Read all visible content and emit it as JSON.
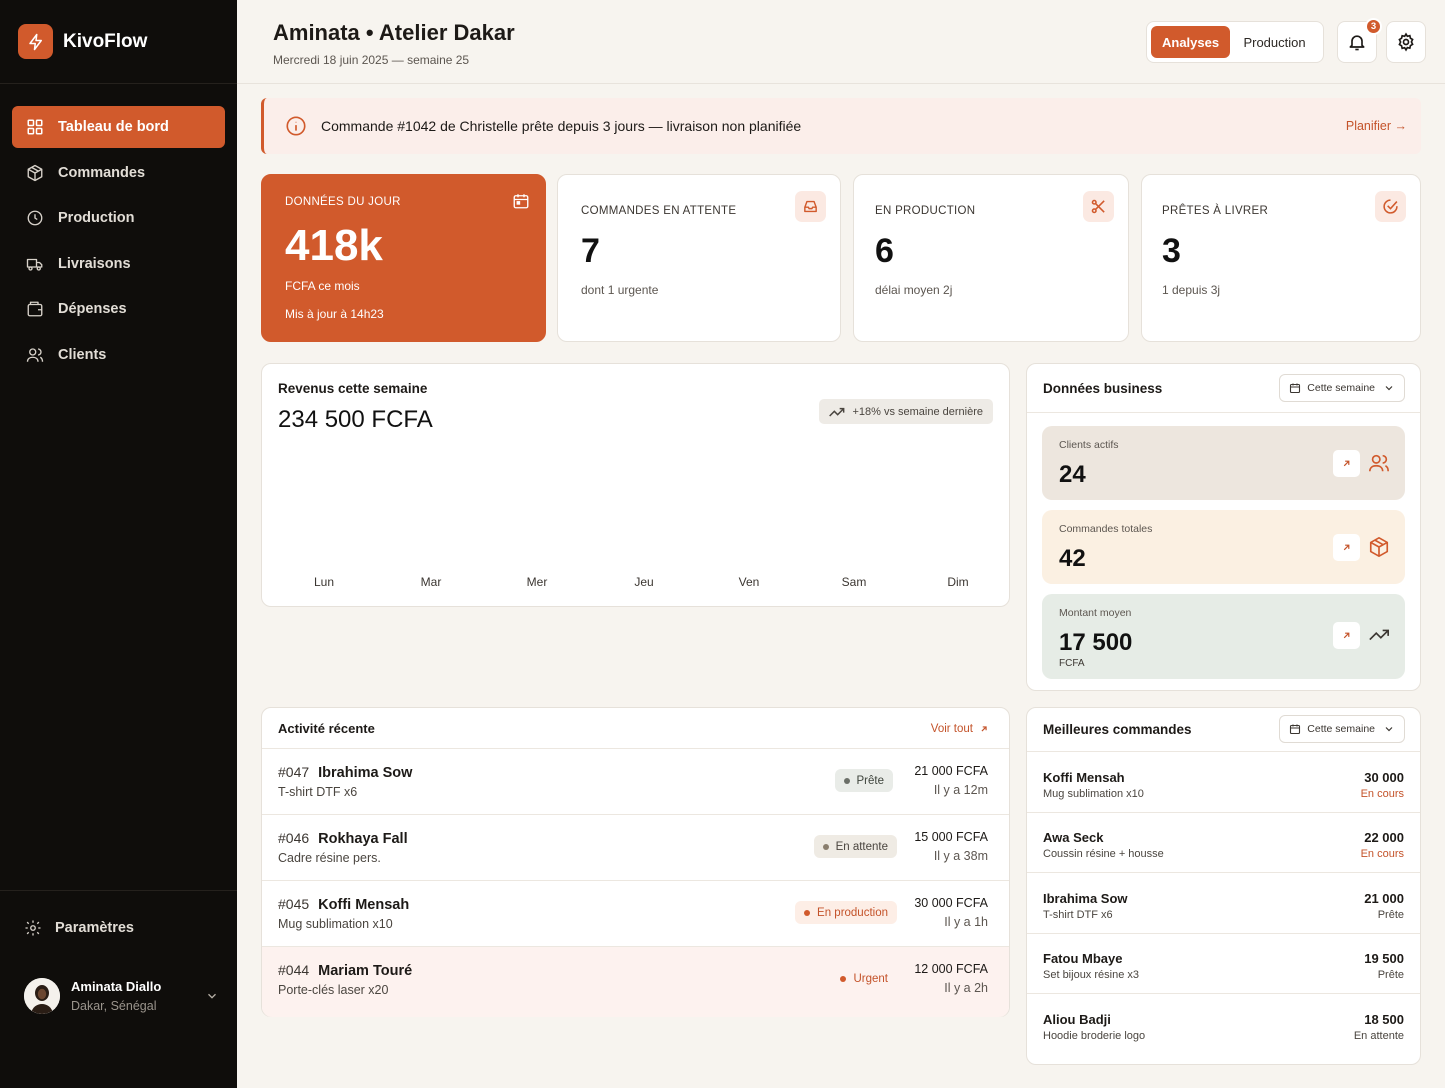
{
  "brand": {
    "name": "KivoFlow"
  },
  "nav": {
    "items": [
      {
        "label": "Tableau de bord",
        "icon": "dashboard-icon"
      },
      {
        "label": "Commandes",
        "icon": "box-icon"
      },
      {
        "label": "Production",
        "icon": "clock-icon"
      },
      {
        "label": "Livraisons",
        "icon": "truck-icon"
      },
      {
        "label": "Dépenses",
        "icon": "wallet-icon"
      },
      {
        "label": "Clients",
        "icon": "users-icon"
      }
    ],
    "settings": "Paramètres"
  },
  "user": {
    "name": "Aminata Diallo",
    "location": "Dakar, Sénégal"
  },
  "header": {
    "title": "Aminata • Atelier Dakar",
    "subtitle": "Mercredi 18 juin 2025 — semaine 25",
    "tabs": [
      "Analyses",
      "Production"
    ],
    "notifications": "3"
  },
  "alert": {
    "text": "Commande #1042 de Christelle prête depuis 3 jours — livraison non planifiée",
    "action": "Planifier →"
  },
  "stats": [
    {
      "label": "DONNÉES DU JOUR",
      "value": "418k",
      "sub": "FCFA ce mois",
      "sub2": "Mis à jour à 14h23"
    },
    {
      "label": "COMMANDES EN ATTENTE",
      "value": "7",
      "sub": "dont 1 urgente"
    },
    {
      "label": "EN PRODUCTION",
      "value": "6",
      "sub": "délai moyen 2j"
    },
    {
      "label": "PRÊTES À LIVRER",
      "value": "3",
      "sub": "1 depuis 3j"
    }
  ],
  "revenue": {
    "title": "Revenus cette semaine",
    "value": "234 500 FCFA",
    "trend": "+18% vs semaine dernière",
    "days": [
      "Lun",
      "Mar",
      "Mer",
      "Jeu",
      "Ven",
      "Sam",
      "Dim"
    ]
  },
  "business": {
    "title": "Données business",
    "period": "Cette semaine",
    "items": [
      {
        "label": "Clients actifs",
        "value": "24",
        "unit": ""
      },
      {
        "label": "Commandes totales",
        "value": "42",
        "unit": ""
      },
      {
        "label": "Montant moyen",
        "value": "17 500",
        "unit": "FCFA"
      }
    ]
  },
  "activity": {
    "title": "Activité récente",
    "see_all": "Voir tout",
    "rows": [
      {
        "id": "#047",
        "name": "Ibrahima Sow",
        "desc": "T-shirt DTF x6",
        "status": "Prête",
        "amount": "21 000 FCFA",
        "time": "Il y a 12m"
      },
      {
        "id": "#046",
        "name": "Rokhaya Fall",
        "desc": "Cadre résine pers.",
        "status": "En attente",
        "amount": "15 000 FCFA",
        "time": "Il y a 38m"
      },
      {
        "id": "#045",
        "name": "Koffi Mensah",
        "desc": "Mug sublimation x10",
        "status": "En production",
        "amount": "30 000 FCFA",
        "time": "Il y a 1h"
      },
      {
        "id": "#044",
        "name": "Mariam Touré",
        "desc": "Porte-clés laser x20",
        "status": "Urgent",
        "amount": "12 000 FCFA",
        "time": "Il y a 2h"
      }
    ]
  },
  "best": {
    "title": "Meilleures commandes",
    "period": "Cette semaine",
    "rows": [
      {
        "name": "Koffi Mensah",
        "desc": "Mug sublimation x10",
        "amount": "30 000",
        "status": "En cours"
      },
      {
        "name": "Awa Seck",
        "desc": "Coussin résine + housse",
        "amount": "22 000",
        "status": "En cours"
      },
      {
        "name": "Ibrahima Sow",
        "desc": "T-shirt DTF x6",
        "amount": "21 000",
        "status": "Prête"
      },
      {
        "name": "Fatou Mbaye",
        "desc": "Set bijoux résine x3",
        "amount": "19 500",
        "status": "Prête"
      },
      {
        "name": "Aliou Badji",
        "desc": "Hoodie broderie logo",
        "amount": "18 500",
        "status": "En attente"
      }
    ]
  },
  "colors": {
    "accent": "#d15a2c",
    "sidebar": "#0f0d0b",
    "background": "#f7f4ef"
  }
}
